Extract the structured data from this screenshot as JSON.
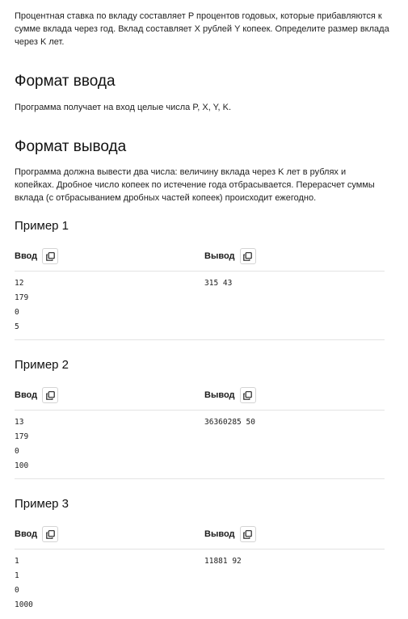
{
  "statement": {
    "intro": "Процентная ставка по вкладу составляет P процентов годовых, которые прибавляются к сумме вклада через год. Вклад составляет X рублей Y копеек. Определите размер вклада через K лет.",
    "input_heading": "Формат ввода",
    "input_text": "Программа получает на вход целые числа P, X, Y, K.",
    "output_heading": "Формат вывода",
    "output_text": "Программа должна вывести два числа: величину вклада через K лет в рублях и копейках. Дробное число копеек по истечение года отбрасывается. Перерасчет суммы вклада (с отбрасыванием дробных частей копеек) происходит ежегодно."
  },
  "examples": [
    {
      "title": "Пример 1",
      "input_label": "Ввод",
      "output_label": "Вывод",
      "input": "12\n179\n0\n5",
      "output": "315 43"
    },
    {
      "title": "Пример 2",
      "input_label": "Ввод",
      "output_label": "Вывод",
      "input": "13\n179\n0\n100",
      "output": "36360285 50"
    },
    {
      "title": "Пример 3",
      "input_label": "Ввод",
      "output_label": "Вывод",
      "input": "1\n1\n0\n1000",
      "output": "11881 92"
    }
  ],
  "icons": {
    "copy": "copy-icon"
  }
}
